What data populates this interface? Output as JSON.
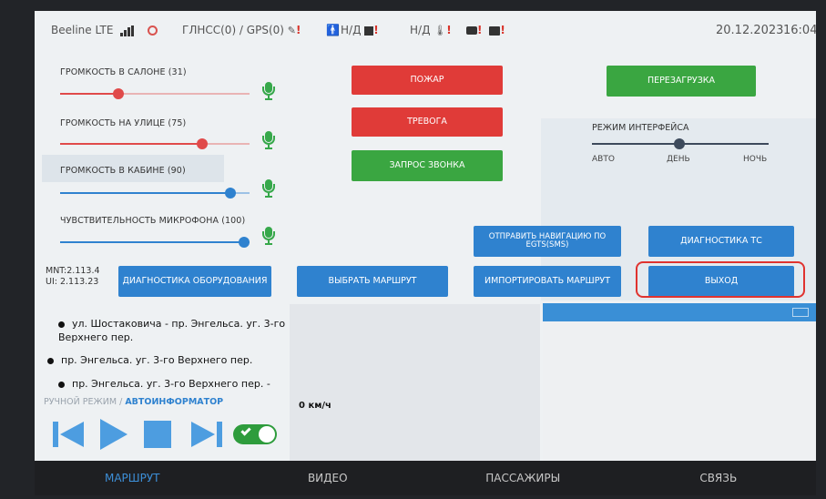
{
  "status_bar": {
    "network": "Beeline LTE",
    "gnss": "ГЛНСС(0) / GPS(0)",
    "value1": "Н/Д",
    "value2": "Н/Д",
    "date": "20.12.2023",
    "time": "16:04",
    "warning": "!"
  },
  "sliders": [
    {
      "label": "ГРОМКОСТЬ В САЛОНЕ (31)",
      "value_percent": 31,
      "color": "#e04a4a"
    },
    {
      "label": "ГРОМКОСТЬ НА УЛИЦЕ (75)",
      "value_percent": 75,
      "color": "#e04a4a"
    },
    {
      "label": "ГРОМКОСТЬ В КАБИНЕ (90)",
      "value_percent": 90,
      "color": "#2f82cf"
    },
    {
      "label": "ЧУВСТВИТЕЛЬНОСТЬ МИКРОФОНА (100)",
      "value_percent": 100,
      "color": "#2f82cf"
    }
  ],
  "buttons": {
    "fire": "ПОЖАР",
    "alarm": "ТРЕВОГА",
    "call_request": "ЗАПРОС ЗВОНКА",
    "reboot": "ПЕРЕЗАГРУЗКА",
    "send_nav": "ОТПРАВИТЬ НАВИГАЦИЮ ПО EGTS(SMS)",
    "vehicle_diag": "ДИАГНОСТИКА ТС",
    "hw_diag": "ДИАГНОСТИКА ОБОРУДОВАНИЯ",
    "select_route": "ВЫБРАТЬ МАРШРУТ",
    "import_route": "ИМПОРТИРОВАТЬ МАРШРУТ",
    "exit": "ВЫХОД"
  },
  "interface_mode": {
    "label": "РЕЖИМ ИНТЕРФЕЙСА",
    "options": [
      "АВТО",
      "ДЕНЬ",
      "НОЧЬ"
    ],
    "selected": "ДЕНЬ"
  },
  "version": {
    "mnt": "MNT:2.113.4",
    "ui": "UI: 2.113.23"
  },
  "route_list": [
    "ул. Шостаковича - пр. Энгельса. уг. 3-го Верхнего пер.",
    "пр. Энгельса. уг. 3-го Верхнего пер.",
    "пр. Энгельса. уг. 3-го Верхнего пер. -"
  ],
  "mode_switch": {
    "manual": "РУЧНОЙ РЕЖИМ",
    "separator": "/",
    "auto": "АВТОИНФОРМАТОР"
  },
  "speed": "0 км/ч",
  "tabs": [
    "МАРШРУТ",
    "ВИДЕО",
    "ПАССАЖИРЫ",
    "СВЯЗЬ"
  ],
  "active_tab": "МАРШРУТ",
  "colors": {
    "red": "#e03b38",
    "green": "#3aa641",
    "blue": "#2f82cf",
    "tab_active": "#3d8fd8",
    "highlight": "#e0332f"
  }
}
